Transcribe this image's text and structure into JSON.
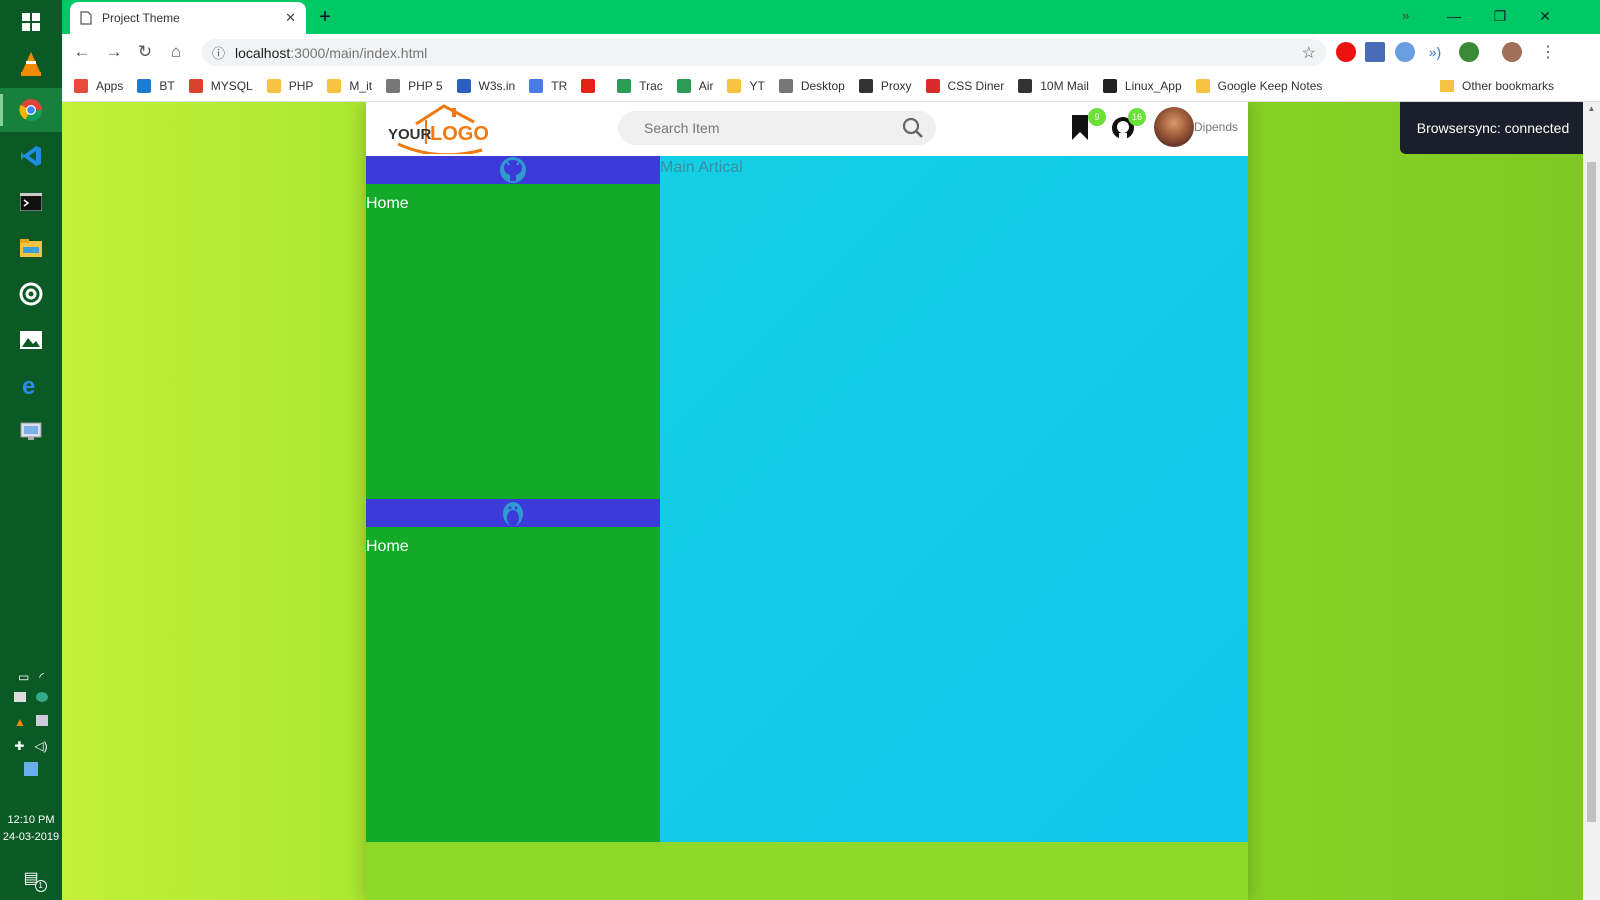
{
  "taskbar": {
    "apps": [
      "windows-icon",
      "vlc-icon",
      "chrome-icon",
      "vscode-icon",
      "terminal-icon",
      "file-explorer-icon",
      "target-icon",
      "photos-icon",
      "edge-icon",
      "remote-desktop-icon"
    ],
    "clock_time": "12:10 PM",
    "clock_date": "24-03-2019",
    "notification_count": "1"
  },
  "browser": {
    "tab_title": "Project Theme",
    "url_scheme": "localhost",
    "url_rest": ":3000/main/index.html",
    "bookmarks": [
      {
        "label": "Apps",
        "icon": "apps-grid-icon",
        "color": "#e84a3c"
      },
      {
        "label": "BT",
        "icon": "bing-icon",
        "color": "#1b7bd1"
      },
      {
        "label": "MYSQL",
        "icon": "gmail-icon",
        "color": "#d9442b"
      },
      {
        "label": "PHP",
        "icon": "folder-icon",
        "color": "#f5c242"
      },
      {
        "label": "M_it",
        "icon": "folder-icon",
        "color": "#f5c242"
      },
      {
        "label": "PHP 5",
        "icon": "page-icon",
        "color": "#777777"
      },
      {
        "label": "W3s.in",
        "icon": "w3-icon",
        "color": "#2b5fbf"
      },
      {
        "label": "TR",
        "icon": "translate-icon",
        "color": "#4a7ce8"
      },
      {
        "label": "",
        "icon": "youtube-icon",
        "color": "#e62117"
      },
      {
        "label": "Trac",
        "icon": "plane-icon",
        "color": "#2a9c54"
      },
      {
        "label": "Air",
        "icon": "plane-icon",
        "color": "#2a9c54"
      },
      {
        "label": "YT",
        "icon": "folder-icon",
        "color": "#f5c242"
      },
      {
        "label": "Desktop",
        "icon": "page-icon",
        "color": "#777777"
      },
      {
        "label": "Proxy",
        "icon": "fire-icon",
        "color": "#333333"
      },
      {
        "label": "CSS Diner",
        "icon": "dot-icon",
        "color": "#d92b2b"
      },
      {
        "label": "10M Mail",
        "icon": "mail10-icon",
        "color": "#333333"
      },
      {
        "label": "Linux_App",
        "icon": "linux-app-icon",
        "color": "#222222"
      },
      {
        "label": "Google Keep Notes",
        "icon": "keep-icon",
        "color": "#f5c242"
      }
    ],
    "more_bookmarks": "»",
    "other_bookmarks": "Other bookmarks"
  },
  "site": {
    "logo_text_left": "YOUR",
    "logo_text_right": "LOGO",
    "search_placeholder": "Search Item",
    "bookmark_badge": "9",
    "github_badge": "16",
    "username": "Dipends",
    "sidebar": [
      {
        "icon": "github-icon",
        "link": "Home"
      },
      {
        "icon": "linux-icon",
        "link": "Home"
      }
    ],
    "main_title": "Main Artical",
    "toast": "Browsersync: connected"
  },
  "colors": {
    "tabstrip": "#00c864",
    "sidebar_head": "#3c3ad8",
    "sidebar_body": "#13aa2a",
    "main": "#14cfe6",
    "footer": "#8ed82a"
  }
}
